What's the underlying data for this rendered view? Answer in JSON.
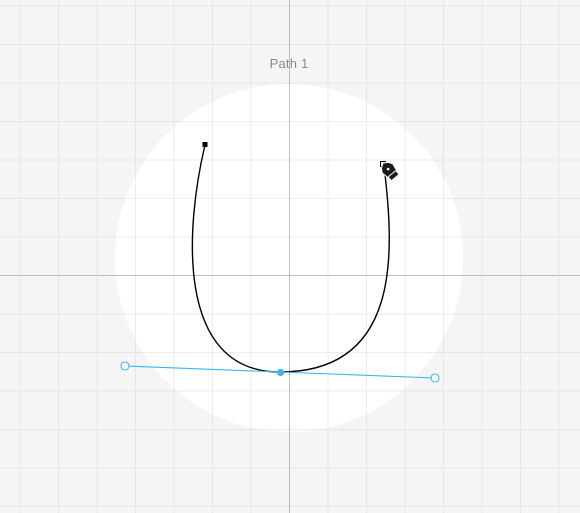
{
  "canvas": {
    "path_label": "Path 1",
    "background_color": "#f5f5f5",
    "artboard_color": "#ffffff",
    "grid_color": "#e3e3e3",
    "axis_color": "#b8b8b8",
    "path_color": "#000000",
    "handle_color": "#3fb5ec"
  },
  "tool": {
    "active": "pen-tool",
    "cursor_icon": "pen-tool-icon"
  }
}
